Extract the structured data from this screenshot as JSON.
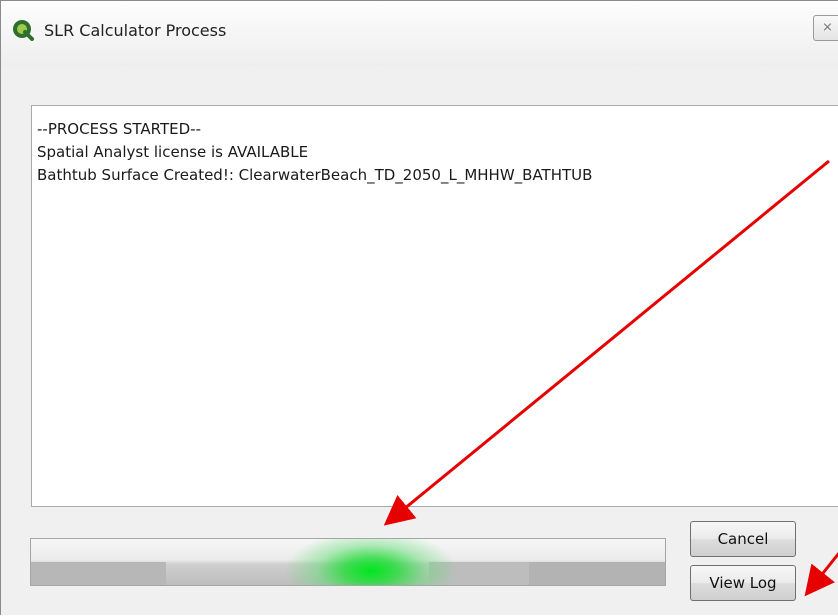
{
  "window": {
    "title": "SLR Calculator Process",
    "close_glyph": "⨯"
  },
  "output": {
    "lines": [
      "--PROCESS STARTED--",
      "Spatial Analyst license is AVAILABLE",
      "Bathtub Surface Created!: ClearwaterBeach_TD_2050_L_MHHW_BATHTUB"
    ]
  },
  "buttons": {
    "cancel_label": "Cancel",
    "view_log_label": "View Log"
  },
  "progress": {
    "state": "indeterminate (marquee)"
  },
  "colors": {
    "progress_glow": "#00e61e",
    "annotation_arrow": "#e60000",
    "window_bg": "#f0f0f0"
  },
  "icons": {
    "app": "qgis-logo-icon",
    "close": "close-icon"
  }
}
